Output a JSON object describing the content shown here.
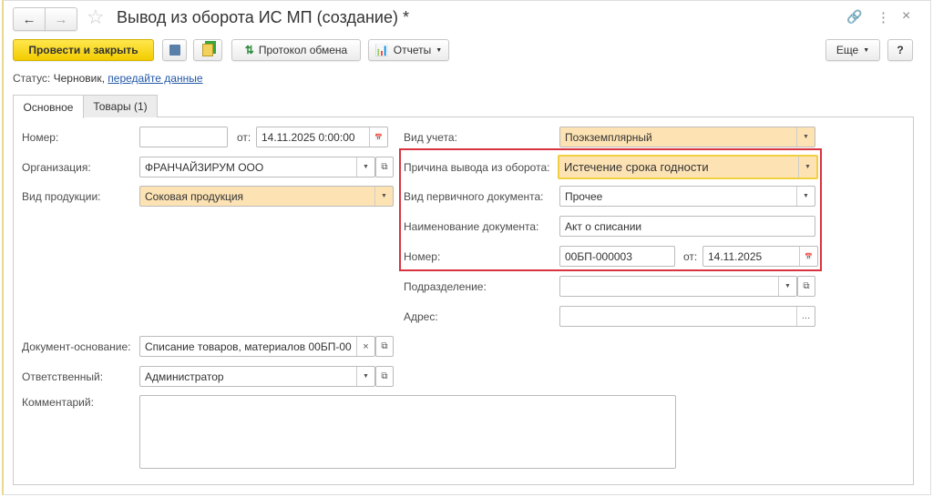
{
  "window": {
    "title": "Вывод из оборота ИС МП (создание) *"
  },
  "toolbar": {
    "post_close": "Провести и закрыть",
    "exchange_log": "Протокол обмена",
    "reports": "Отчеты",
    "more": "Еще",
    "help": "?"
  },
  "status": {
    "label": "Статус:",
    "value": "Черновик,",
    "link": "передайте данные"
  },
  "tabs": [
    {
      "label": "Основное"
    },
    {
      "label": "Товары (1)"
    }
  ],
  "left": {
    "number": {
      "label": "Номер:",
      "value": "",
      "from_label": "от:",
      "date": "14.11.2025  0:00:00"
    },
    "organization": {
      "label": "Организация:",
      "value": "ФРАНЧАЙЗИРУМ ООО"
    },
    "product_type": {
      "label": "Вид продукции:",
      "value": "Соковая продукция"
    },
    "base_doc": {
      "label": "Документ-основание:",
      "value": "Списание товаров, материалов 00БП-00"
    },
    "responsible": {
      "label": "Ответственный:",
      "value": "Администратор"
    },
    "comment": {
      "label": "Комментарий:",
      "value": ""
    }
  },
  "right": {
    "accounting_type": {
      "label": "Вид учета:",
      "value": "Поэкземплярный"
    },
    "withdrawal_reason": {
      "label": "Причина вывода из оборота:",
      "value": "Истечение срока годности"
    },
    "primary_doc_type": {
      "label": "Вид первичного документа:",
      "value": "Прочее"
    },
    "doc_name": {
      "label": "Наименование документа:",
      "value": "Акт о списании"
    },
    "doc_number": {
      "label": "Номер:",
      "value": "00БП-000003",
      "from_label": "от:",
      "date": "14.11.2025"
    },
    "department": {
      "label": "Подразделение:",
      "value": ""
    },
    "address": {
      "label": "Адрес:",
      "value": ""
    }
  },
  "colors": {
    "accent": "#f5d000",
    "highlight_box": "#d9333f",
    "required_fill": "#fde3b4"
  }
}
